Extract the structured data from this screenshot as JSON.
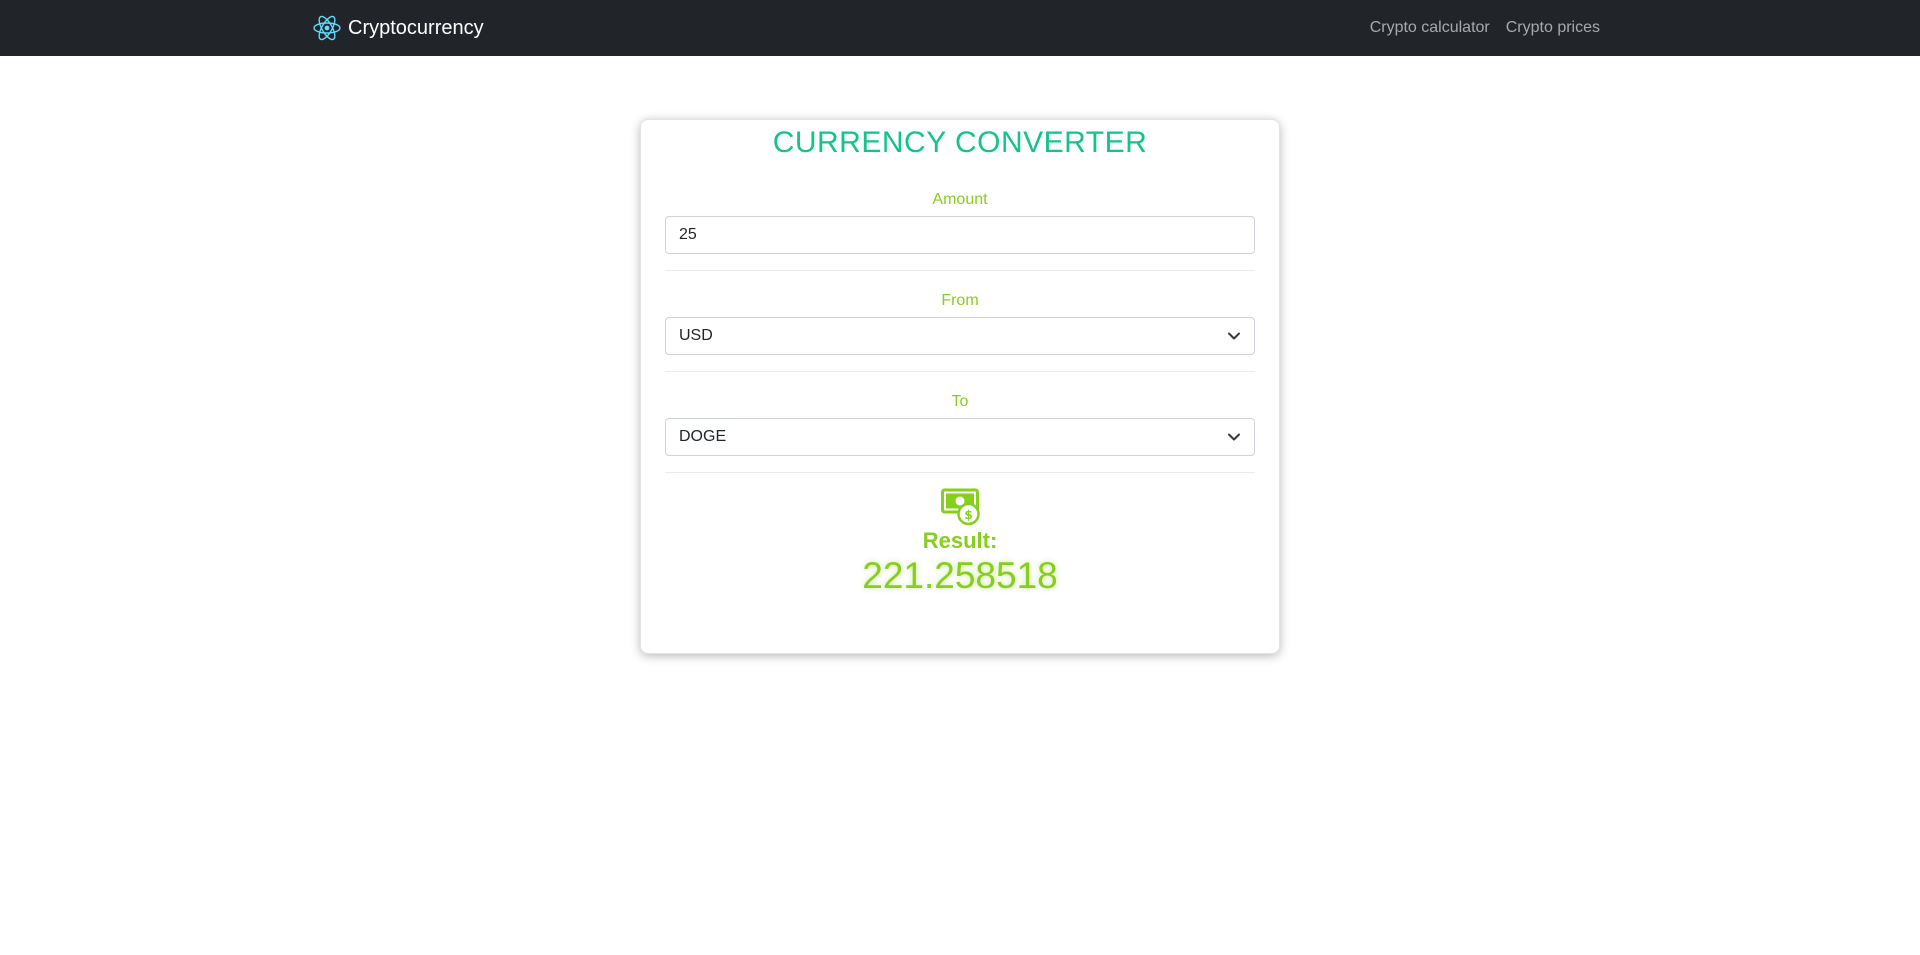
{
  "navbar": {
    "brand": "Cryptocurrency",
    "brand_icon": "react-atom-icon",
    "links": [
      "Crypto calculator",
      "Crypto prices"
    ]
  },
  "converter": {
    "title": "CURRENCY CONVERTER",
    "amount_label": "Amount",
    "amount_value": "25",
    "from_label": "From",
    "from_value": "USD",
    "to_label": "To",
    "to_value": "DOGE",
    "result_icon": "money-bill-icon",
    "result_label": "Result:",
    "result_value": "221.258518"
  },
  "colors": {
    "navbar_bg": "#212529",
    "title": "#12c48b",
    "accent": "#86cf1c",
    "brand_icon": "#61dafb"
  }
}
